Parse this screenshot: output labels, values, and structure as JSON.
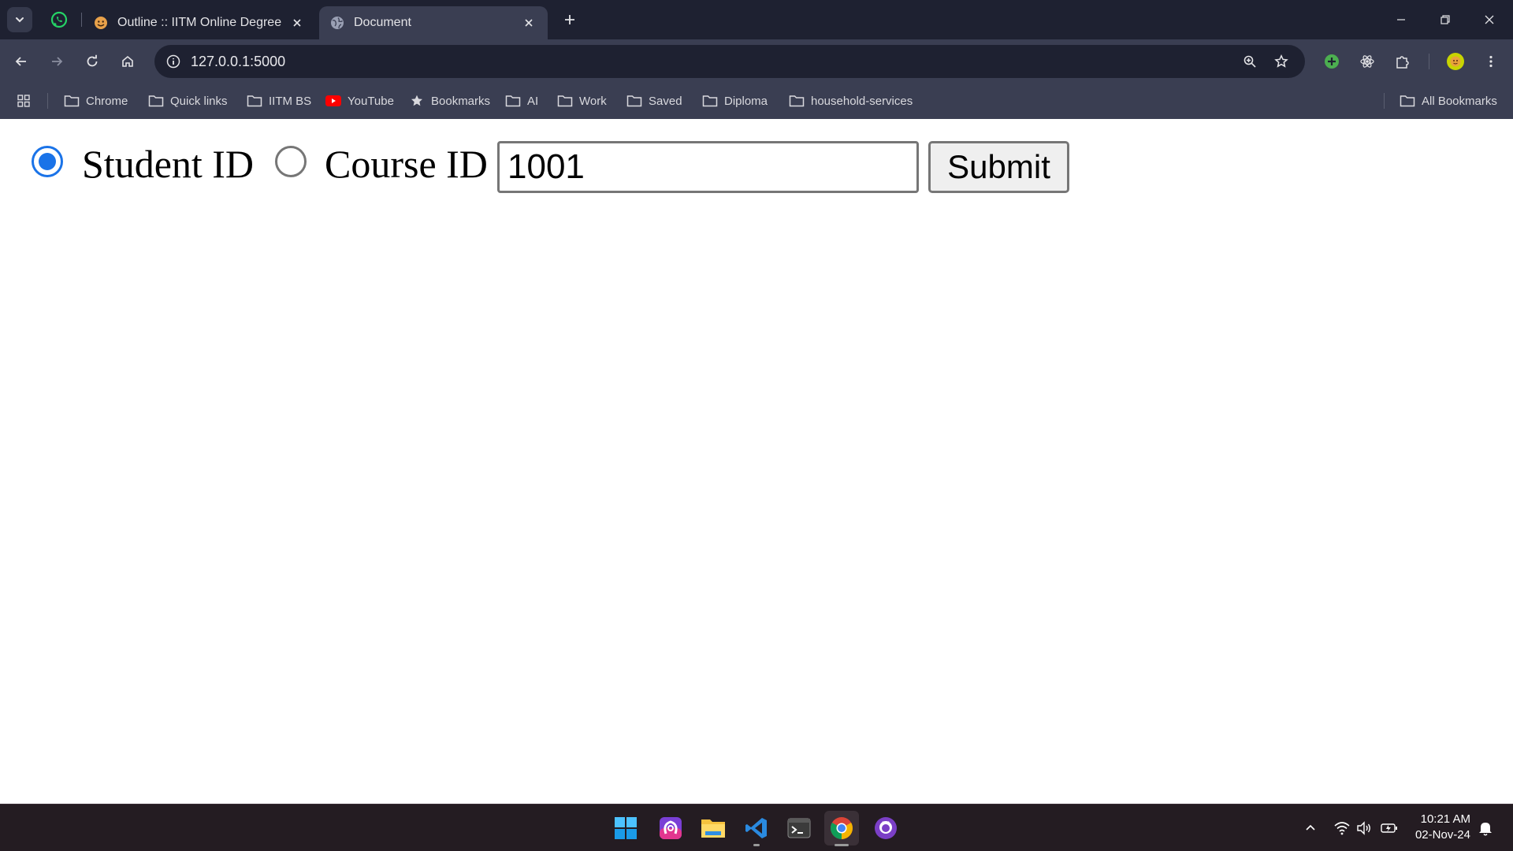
{
  "browser": {
    "tabs": [
      {
        "title": "Outline :: IITM Online Degree",
        "active": false,
        "favicon": "emoji-face-icon"
      },
      {
        "title": "Document",
        "active": true,
        "favicon": "globe-icon"
      }
    ],
    "pinned_tab_icon": "whatsapp-icon",
    "address_bar": {
      "url": "127.0.0.1:5000"
    },
    "bookmarks": [
      {
        "label": "Chrome",
        "icon": "folder-icon"
      },
      {
        "label": "Quick links",
        "icon": "folder-icon"
      },
      {
        "label": "IITM BS",
        "icon": "folder-icon"
      },
      {
        "label": "YouTube",
        "icon": "youtube-icon"
      },
      {
        "label": "Bookmarks",
        "icon": "star-icon"
      },
      {
        "label": "AI",
        "icon": "folder-icon"
      },
      {
        "label": "Work",
        "icon": "folder-icon"
      },
      {
        "label": "Saved",
        "icon": "folder-icon"
      },
      {
        "label": "Diploma",
        "icon": "folder-icon"
      },
      {
        "label": "household-services",
        "icon": "folder-icon"
      }
    ],
    "all_bookmarks": "All Bookmarks"
  },
  "page": {
    "search_type": {
      "options": [
        {
          "label": "Student ID",
          "checked": true
        },
        {
          "label": "Course ID",
          "checked": false
        }
      ]
    },
    "id_input": {
      "value": "1001"
    },
    "submit_label": "Submit"
  },
  "taskbar": {
    "apps": [
      "windows-start-icon",
      "arc-browser-icon",
      "file-explorer-icon",
      "vscode-icon",
      "terminal-icon",
      "chrome-icon",
      "github-desktop-icon"
    ],
    "clock": {
      "time": "10:21 AM",
      "date": "02-Nov-24"
    }
  },
  "colors": {
    "tabstrip": "#1e2131",
    "toolbar": "#3a3e52",
    "radio_accent": "#1a73e8",
    "taskbar": "#241c22"
  }
}
